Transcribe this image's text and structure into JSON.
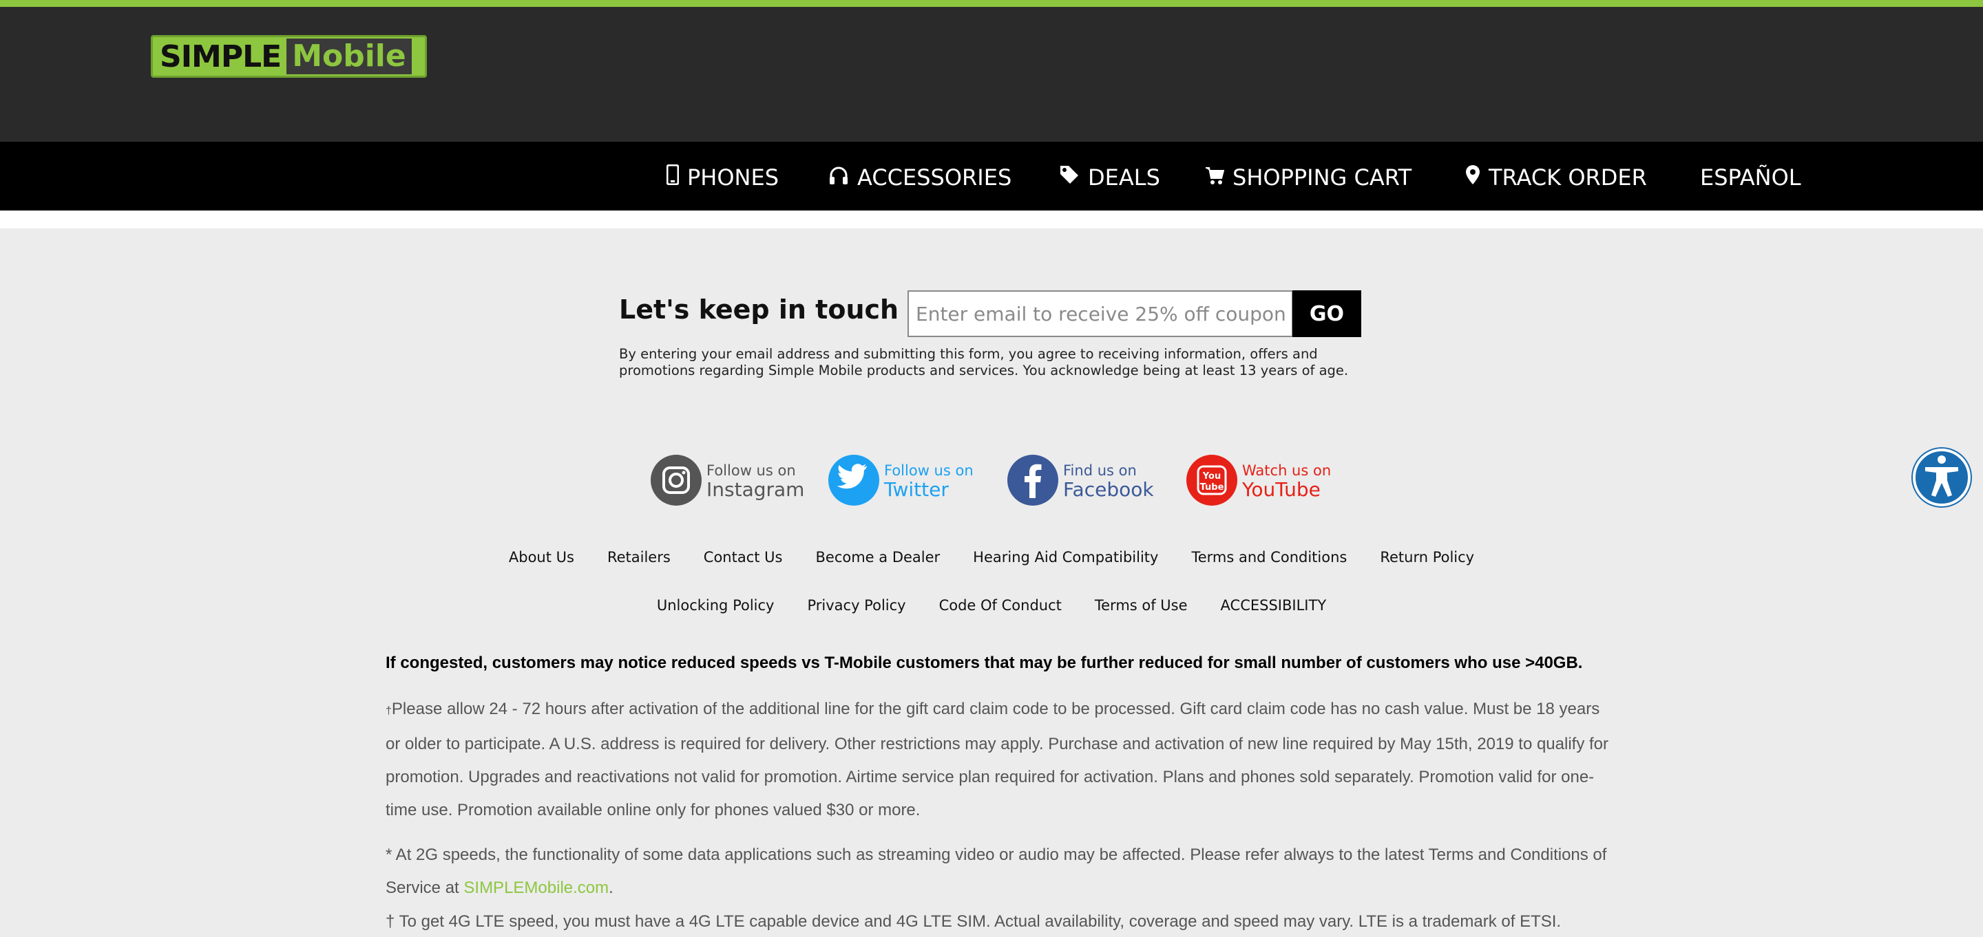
{
  "brand": {
    "logo_part1": "SIMPLE",
    "logo_part2": "Mobile",
    "green": "#8dc63f",
    "dark": "#2a2a2a"
  },
  "nav": {
    "items": [
      {
        "label": "PHONES",
        "icon": "phone-icon"
      },
      {
        "label": "ACCESSORIES",
        "icon": "headphones-icon"
      },
      {
        "label": "DEALS",
        "icon": "tag-icon"
      },
      {
        "label": "SHOPPING CART",
        "icon": "cart-icon"
      },
      {
        "label": "TRACK ORDER",
        "icon": "map-pin-icon"
      },
      {
        "label": "ESPAÑOL",
        "icon": ""
      }
    ]
  },
  "newsletter": {
    "heading": "Let's keep in touch",
    "placeholder": "Enter email to receive 25% off coupon",
    "button": "GO",
    "disclaimer": "By entering your email address and submitting this form, you agree to receiving information, offers and promotions regarding Simple Mobile products and services. You acknowledge being at least 13 years of age."
  },
  "social": [
    {
      "line1": "Follow us on",
      "line2": "Instagram",
      "icon": "instagram-icon",
      "color": "#555555"
    },
    {
      "line1": "Follow us on",
      "line2": "Twitter",
      "icon": "twitter-icon",
      "color": "#1da1f2"
    },
    {
      "line1": "Find us on",
      "line2": "Facebook",
      "icon": "facebook-icon",
      "color": "#3b5998"
    },
    {
      "line1": "Watch us on",
      "line2": "YouTube",
      "icon": "youtube-icon",
      "color": "#e62117"
    }
  ],
  "footer_links": {
    "row1": [
      "About Us",
      "Retailers",
      "Contact Us",
      "Become a Dealer",
      "Hearing Aid Compatibility",
      "Terms and Conditions",
      "Return Policy"
    ],
    "row2": [
      "Unlocking Policy",
      "Privacy Policy",
      "Code Of Conduct",
      "Terms of Use",
      "ACCESSIBILITY"
    ]
  },
  "legal": {
    "congested": "If congested, customers may notice reduced speeds vs T-Mobile customers that may be further reduced for small number of customers who use >40GB.",
    "gift_dagger": "†",
    "gift": "Please allow 24 - 72 hours after activation of the additional line for the gift card claim code to be processed. Gift card claim code has no cash value. Must be 18 years or older to participate. A U.S. address is required for delivery. Other restrictions may apply. Purchase and activation of new line required by May 15th, 2019 to qualify for promotion. Upgrades and reactivations not valid for promotion. Airtime service plan required for activation. Plans and phones sold separately. Promotion valid for one-time use. Promotion available online only for phones valued $30 or more.",
    "speed_prefix": "* At 2G speeds, the functionality of some data applications such as streaming video or audio may be affected. Please refer always to the latest Terms and Conditions of Service at ",
    "speed_link": "SIMPLEMobile.com",
    "speed_suffix": ".",
    "lte": "† To get 4G LTE speed, you must have a 4G LTE capable device and 4G LTE SIM. Actual availability, coverage and speed may vary. LTE is a trademark of ETSI."
  },
  "accessibility_widget": {
    "icon": "accessibility-icon",
    "color": "#1a6cb0"
  }
}
